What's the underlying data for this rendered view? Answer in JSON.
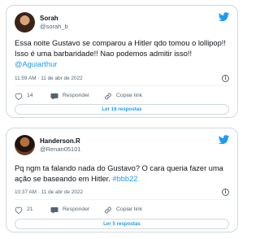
{
  "tweets": [
    {
      "name": "Sorah",
      "handle": "@sorah_b",
      "text": "Essa noite Gustavo se comparou a Hitler qdo tomou o lollipop!! Isso é uma barbaridade!! Nao podemos admitir isso!! ",
      "mention": "@Aguiarthur",
      "meta": "11:59 AM · 11 de abr de 2022",
      "likes": "14",
      "reply_label": "Responder",
      "copy_label": "Copiar link",
      "more_label": "Ler 16 respostas"
    },
    {
      "name": "Handerson.R",
      "handle": "@Renan05101",
      "text": "Pq ngm ta falando nada do Gustavo? O cara queria fazer uma ação se baseando em Hitler. ",
      "hashtag": "#bbb22",
      "meta": "10:37 AM · 11 de abr de 2022",
      "likes": "21",
      "reply_label": "Responder",
      "copy_label": "Copiar link",
      "more_label": "Ler 5 respostas"
    }
  ],
  "icons": [
    "twitter-bird-icon",
    "info-icon",
    "heart-icon",
    "reply-icon",
    "link-icon"
  ],
  "colors": {
    "accent": "#1d9bf0",
    "muted": "#536471",
    "border": "#cfd9de"
  }
}
